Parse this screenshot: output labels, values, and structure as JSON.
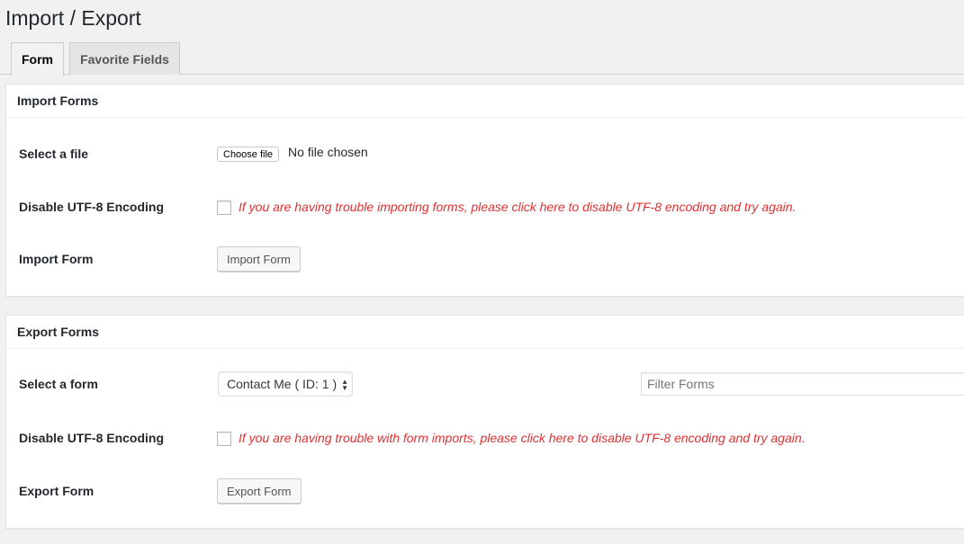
{
  "page": {
    "title": "Import / Export"
  },
  "tabs": [
    {
      "label": "Form",
      "active": true
    },
    {
      "label": "Favorite Fields",
      "active": false
    }
  ],
  "import": {
    "header": "Import Forms",
    "select_file_label": "Select a file",
    "choose_file_button": "Choose file",
    "file_status": "No file chosen",
    "disable_utf8_label": "Disable UTF-8 Encoding",
    "disable_utf8_hint": "If you are having trouble importing forms, please click here to disable UTF-8 encoding and try again.",
    "import_form_label": "Import Form",
    "import_form_button": "Import Form"
  },
  "export": {
    "header": "Export Forms",
    "select_form_label": "Select a form",
    "selected_form": "Contact Me ( ID: 1 )",
    "filter_placeholder": "Filter Forms",
    "disable_utf8_label": "Disable UTF-8 Encoding",
    "disable_utf8_hint": "If you are having trouble with form imports, please click here to disable UTF-8 encoding and try again.",
    "export_form_label": "Export Form",
    "export_form_button": "Export Form"
  },
  "colors": {
    "hint_red": "#dc3232",
    "background": "#f1f1f1",
    "panel": "#ffffff"
  }
}
